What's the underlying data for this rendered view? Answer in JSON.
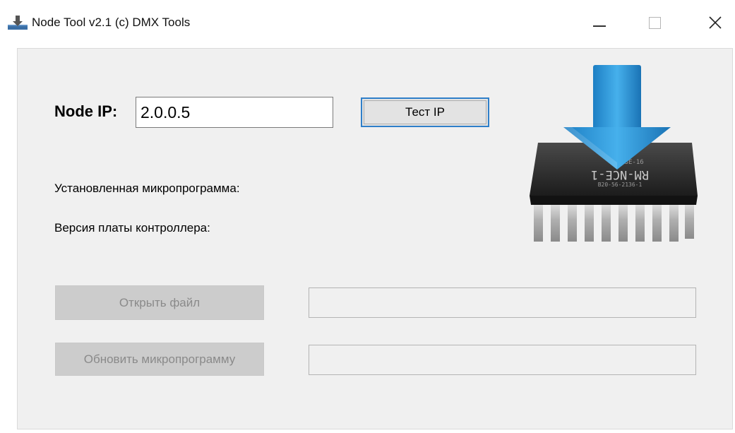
{
  "window": {
    "title": "Node Tool v2.1  (c) DMX Tools",
    "app_icon": "download-tray-icon",
    "controls": {
      "minimize": "minimize-icon",
      "maximize": "maximize-icon",
      "close": "close-icon",
      "close_glyph": "✕"
    }
  },
  "form": {
    "node_ip_label": "Node IP:",
    "node_ip_value": "2.0.0.5",
    "test_ip_button": "Тест IP",
    "firmware_label": "Установленная микропрограмма:",
    "board_version_label": "Версия платы контроллера:",
    "open_file_button": "Открыть файл",
    "update_firmware_button": "Обновить микропрограмму",
    "open_file_path": "",
    "update_status": ""
  },
  "illustration": {
    "icon": "chip-download-icon",
    "chip_text_line1": "RM-NCE-1",
    "chip_text_line2": "B20-56-2136-1",
    "chip_text_top": "41-3E-16",
    "arrow_color": "#2f9ee0",
    "chip_color": "#2a2a2a"
  },
  "colors": {
    "panel_bg": "#f0f0f0",
    "focus_border": "#2f7fc9",
    "disabled_bg": "#cccccc"
  }
}
